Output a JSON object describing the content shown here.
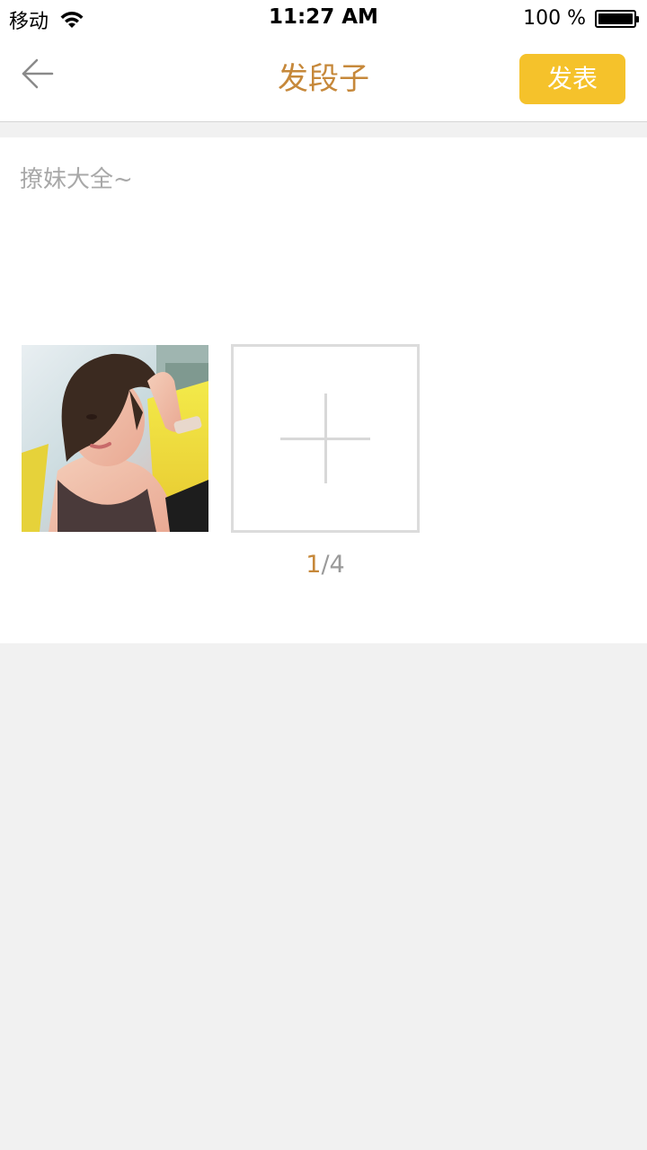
{
  "status_bar": {
    "carrier": "移动",
    "time": "11:27 AM",
    "battery": "100 %"
  },
  "nav": {
    "title": "发段子",
    "publish_label": "发表",
    "back_icon": "arrow-left-icon"
  },
  "compose": {
    "placeholder": "撩妹大全~",
    "value": ""
  },
  "photos": {
    "current": "1",
    "separator": "/",
    "max": "4",
    "add_icon": "plus-icon"
  },
  "colors": {
    "accent": "#c6883a",
    "publish_button": "#f5c22b",
    "background": "#f1f1f1"
  }
}
